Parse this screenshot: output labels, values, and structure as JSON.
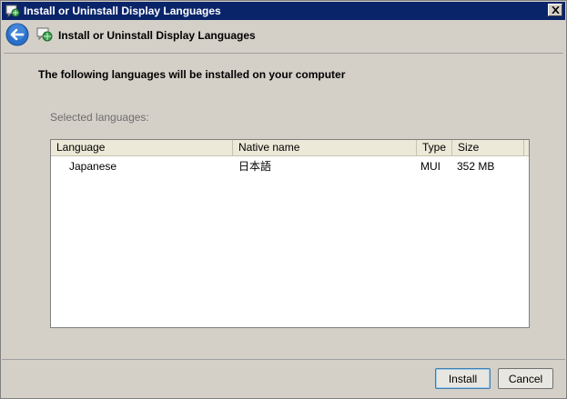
{
  "window": {
    "title": "Install or Uninstall Display Languages"
  },
  "header": {
    "title": "Install or Uninstall Display Languages"
  },
  "content": {
    "instruction": "The following languages will be installed on your computer",
    "selected_label": "Selected languages:"
  },
  "list": {
    "columns": {
      "language": "Language",
      "native": "Native name",
      "type": "Type",
      "size": "Size"
    },
    "rows": [
      {
        "language": "Japanese",
        "native": "日本語",
        "type": "MUI",
        "size": "352 MB"
      }
    ]
  },
  "buttons": {
    "install": "Install",
    "cancel": "Cancel"
  },
  "icons": {
    "title": "language-globe-icon",
    "back": "back-arrow-icon",
    "header": "language-globe-icon",
    "close": "close-icon"
  },
  "colors": {
    "title_bar": "#0a246a",
    "background": "#d4d0c8",
    "back_button": "#2a6fc9"
  }
}
